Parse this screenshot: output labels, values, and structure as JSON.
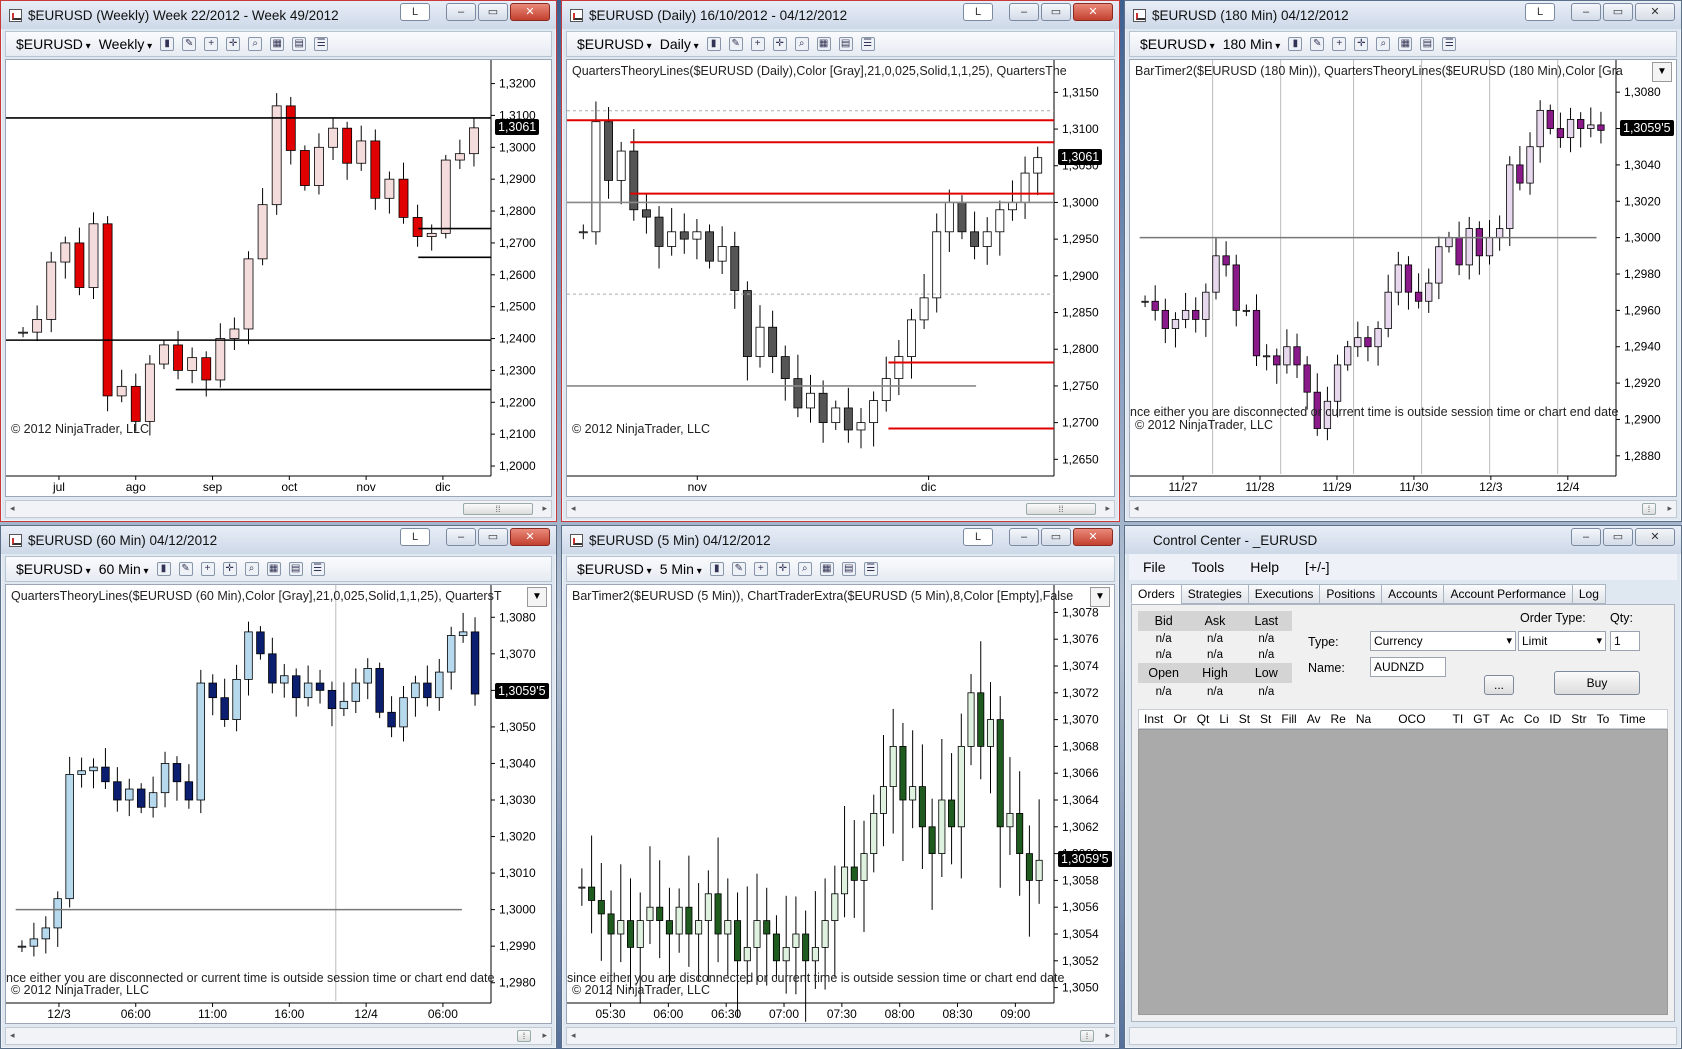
{
  "windows": {
    "weekly": {
      "title": "$EURUSD (Weekly)  Week 22/2012 - Week 49/2012",
      "instrument": "$EURUSD",
      "period": "Weekly",
      "copyright": "© 2012 NinjaTrader, LLC",
      "price_tag": "1,3061",
      "y_ticks": [
        "1,3200",
        "1,3100",
        "1,3000",
        "1,2900",
        "1,2800",
        "1,2700",
        "1,2600",
        "1,2500",
        "1,2400",
        "1,2300",
        "1,2200",
        "1,2100",
        "1,2000"
      ],
      "x_ticks": [
        "jul",
        "ago",
        "sep",
        "oct",
        "nov",
        "dic"
      ]
    },
    "daily": {
      "title": "$EURUSD (Daily)  16/10/2012 - 04/12/2012",
      "instrument": "$EURUSD",
      "period": "Daily",
      "indicator": "QuartersTheoryLines($EURUSD (Daily),Color [Gray],21,0,025,Solid,1,1,25), QuartersThe",
      "copyright": "© 2012 NinjaTrader, LLC",
      "price_tag": "1,3061",
      "y_ticks": [
        "1,3150",
        "1,3100",
        "1,3050",
        "1,3000",
        "1,2950",
        "1,2900",
        "1,2850",
        "1,2800",
        "1,2750",
        "1,2700",
        "1,2650"
      ],
      "x_ticks": [
        "nov",
        "dic"
      ]
    },
    "m180": {
      "title": "$EURUSD (180 Min)  04/12/2012",
      "instrument": "$EURUSD",
      "period": "180 Min",
      "indicator": "BarTimer2($EURUSD (180 Min)), QuartersTheoryLines($EURUSD (180 Min),Color [Gra",
      "status": "nce either you are disconnected or current time is outside session time or chart end date",
      "copyright": "© 2012 NinjaTrader, LLC",
      "price_tag": "1,3059'5",
      "y_ticks": [
        "1,3080",
        "1,3060",
        "1,3040",
        "1,3020",
        "1,3000",
        "1,2980",
        "1,2960",
        "1,2940",
        "1,2920",
        "1,2900",
        "1,2880"
      ],
      "x_ticks": [
        "11/27",
        "11/28",
        "11/29",
        "11/30",
        "12/3",
        "12/4"
      ]
    },
    "m60": {
      "title": "$EURUSD (60 Min)  04/12/2012",
      "instrument": "$EURUSD",
      "period": "60 Min",
      "indicator": "QuartersTheoryLines($EURUSD (60 Min),Color [Gray],21,0,025,Solid,1,1,25), QuartersT",
      "status": "nce either you are disconnected or current time is outside session time or chart end date",
      "copyright": "© 2012 NinjaTrader, LLC",
      "price_tag": "1,3059'5",
      "y_ticks": [
        "1,3080",
        "1,3070",
        "1,3060",
        "1,3050",
        "1,3040",
        "1,3030",
        "1,3020",
        "1,3010",
        "1,3000",
        "1,2990",
        "1,2980"
      ],
      "x_ticks": [
        "12/3",
        "06:00",
        "11:00",
        "16:00",
        "12/4",
        "06:00"
      ]
    },
    "m5": {
      "title": "$EURUSD (5 Min)  04/12/2012",
      "instrument": "$EURUSD",
      "period": "5 Min",
      "indicator": "BarTimer2($EURUSD (5 Min)), ChartTraderExtra($EURUSD (5 Min),8,Color [Empty],False",
      "status": "since either you are disconnected or current time is outside session time or chart end date",
      "copyright": "© 2012 NinjaTrader, LLC",
      "price_tag": "1,3059'5",
      "y_ticks": [
        "1,3078",
        "1,3076",
        "1,3074",
        "1,3072",
        "1,3070",
        "1,3068",
        "1,3066",
        "1,3064",
        "1,3062",
        "1,3060",
        "1,3058",
        "1,3056",
        "1,3054",
        "1,3052",
        "1,3050"
      ],
      "x_ticks": [
        "05:30",
        "06:00",
        "06:30",
        "07:00",
        "07:30",
        "08:00",
        "08:30",
        "09:00"
      ]
    }
  },
  "control_center": {
    "title": "Control Center - _EURUSD",
    "menu": [
      "File",
      "Tools",
      "Help",
      "[+/-]"
    ],
    "tabs": [
      "Orders",
      "Strategies",
      "Executions",
      "Positions",
      "Accounts",
      "Account Performance",
      "Log"
    ],
    "quote_headers1": [
      "Bid",
      "Ask",
      "Last"
    ],
    "quote_values1": [
      "n/a",
      "n/a",
      "n/a"
    ],
    "quote_values2": [
      "n/a",
      "n/a",
      "n/a"
    ],
    "quote_headers2": [
      "Open",
      "High",
      "Low"
    ],
    "quote_values3": [
      "n/a",
      "n/a",
      "n/a"
    ],
    "type_label": "Type:",
    "type_value": "Currency",
    "name_label": "Name:",
    "name_value": "AUDNZD",
    "order_type_label": "Order Type:",
    "order_type_value": "Limit",
    "qty_label": "Qty:",
    "qty_value": "1",
    "ellipsis_button": "...",
    "buy_button": "Buy",
    "order_columns": [
      "Inst",
      "Or",
      "Qt",
      "Li",
      "St",
      "St",
      "Fill",
      "Av",
      "Re",
      "Na",
      "OCO",
      "TI",
      "GT",
      "Ac",
      "Co",
      "ID",
      "Str",
      "To",
      "Time"
    ]
  },
  "common": {
    "btn_l": "L",
    "btn_min": "‒",
    "btn_max": "▭",
    "btn_close": "✕"
  }
}
